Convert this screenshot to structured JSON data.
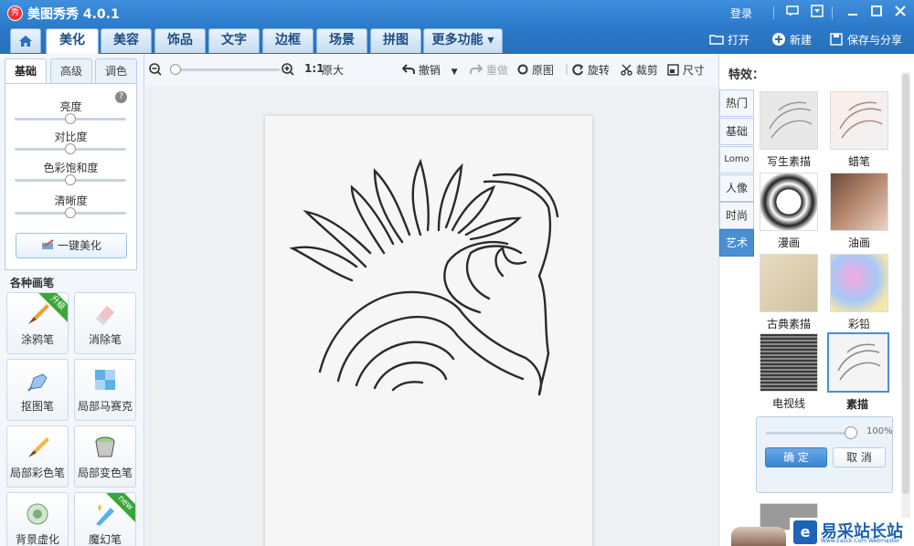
{
  "titlebar": {
    "app_logo": "秀",
    "title": "美图秀秀 4.0.1",
    "login": "登录",
    "icons": [
      "message-icon",
      "skin-icon",
      "minimize-icon",
      "maximize-icon",
      "close-icon"
    ]
  },
  "tabs": {
    "home_icon": "⌂",
    "items": [
      "美化",
      "美容",
      "饰品",
      "文字",
      "边框",
      "场景",
      "拼图"
    ],
    "more": "更多功能 ▾",
    "active": "美化"
  },
  "top_actions": {
    "open": "打开",
    "new": "新建",
    "save_share": "保存与分享"
  },
  "left_panel": {
    "sub_tabs": [
      "基础",
      "高级",
      "调色"
    ],
    "active_sub_tab": "基础",
    "help_icon": "?",
    "sliders": [
      {
        "label": "亮度",
        "level": 0.5
      },
      {
        "label": "对比度",
        "level": 0.5
      },
      {
        "label": "色彩饱和度",
        "level": 0.5
      },
      {
        "label": "清晰度",
        "level": 0.5
      }
    ],
    "one_key": "一键美化",
    "pens_title": "各种画笔",
    "pens": [
      {
        "label": "涂鸦笔",
        "badge": "升级"
      },
      {
        "label": "消除笔",
        "badge": ""
      },
      {
        "label": "抠图笔",
        "badge": ""
      },
      {
        "label": "局部马赛克",
        "badge": ""
      },
      {
        "label": "局部彩色笔",
        "badge": ""
      },
      {
        "label": "局部变色笔",
        "badge": ""
      },
      {
        "label": "背景虚化",
        "badge": ""
      },
      {
        "label": "魔幻笔",
        "badge": "new"
      }
    ]
  },
  "canvas_toolbar": {
    "zoom_level": 0,
    "ratio": "1:1",
    "original_size": "原大",
    "undo": "撤销",
    "redo": "重做",
    "original": "原图",
    "rotate": "旋转",
    "crop": "裁剪",
    "size": "尺寸"
  },
  "right_panel": {
    "title": "特效：",
    "categories": [
      "热门",
      "基础",
      "Lomo",
      "人像",
      "时尚",
      "艺术"
    ],
    "active_category": "艺术",
    "effects": [
      {
        "label": "写生素描"
      },
      {
        "label": "蜡笔"
      },
      {
        "label": "漫画"
      },
      {
        "label": "油画"
      },
      {
        "label": "古典素描"
      },
      {
        "label": "彩铅"
      },
      {
        "label": "电视线"
      },
      {
        "label": "素描"
      }
    ],
    "selected_effect": "素描",
    "intensity": "100%",
    "intensity_level": 1.0,
    "ok": "确 定",
    "cancel": "取 消"
  },
  "watermark": {
    "logo": "e",
    "text": "易采站长站",
    "sub": "Www.Easck.Com Webmaster"
  },
  "colors": {
    "titlebar": "#2c7acb",
    "accent": "#4a8fd2",
    "ribbon_green": "#3aa63a"
  }
}
